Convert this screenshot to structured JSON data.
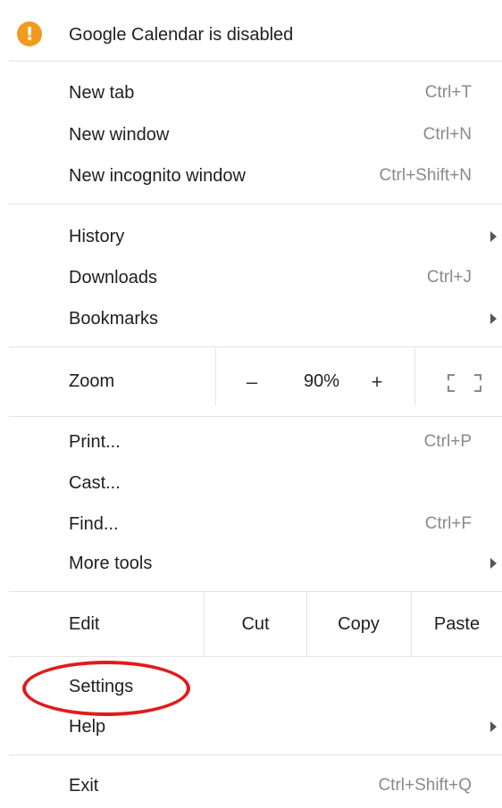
{
  "warning": {
    "label": "Google Calendar is disabled",
    "icon": "warning-icon",
    "icon_color": "#f29a1f"
  },
  "group1": [
    {
      "label": "New tab",
      "shortcut": "Ctrl+T"
    },
    {
      "label": "New window",
      "shortcut": "Ctrl+N"
    },
    {
      "label": "New incognito window",
      "shortcut": "Ctrl+Shift+N"
    }
  ],
  "group2": [
    {
      "label": "History",
      "shortcut": ""
    },
    {
      "label": "Downloads",
      "shortcut": "Ctrl+J"
    },
    {
      "label": "Bookmarks",
      "shortcut": ""
    }
  ],
  "zoom": {
    "label": "Zoom",
    "minus": "–",
    "value": "90%",
    "plus": "+",
    "fullscreen_icon": "fullscreen-icon"
  },
  "group3": [
    {
      "label": "Print...",
      "shortcut": "Ctrl+P"
    },
    {
      "label": "Cast...",
      "shortcut": ""
    },
    {
      "label": "Find...",
      "shortcut": "Ctrl+F"
    },
    {
      "label": "More tools",
      "shortcut": ""
    }
  ],
  "edit": {
    "label": "Edit",
    "cut": "Cut",
    "copy": "Copy",
    "paste": "Paste"
  },
  "group4": [
    {
      "label": "Settings",
      "shortcut": ""
    },
    {
      "label": "Help",
      "shortcut": ""
    }
  ],
  "exit": {
    "label": "Exit",
    "shortcut": "Ctrl+Shift+Q"
  },
  "highlight_color": "#e01b1b"
}
